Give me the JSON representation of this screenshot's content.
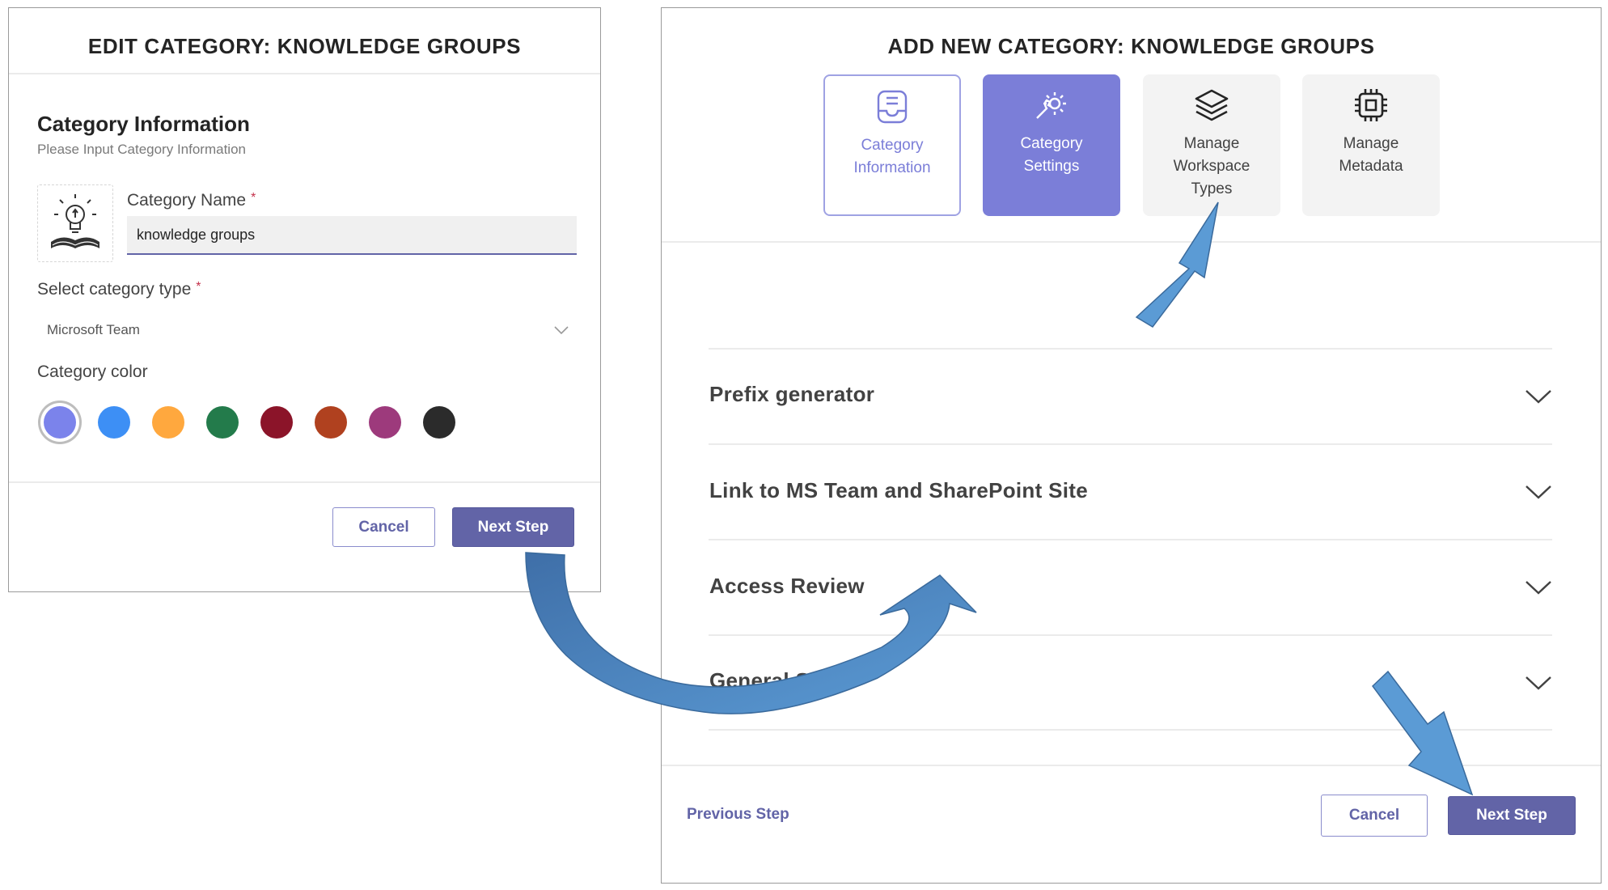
{
  "edit_panel": {
    "title": "EDIT CATEGORY: KNOWLEDGE GROUPS",
    "section_title": "Category Information",
    "section_subtitle": "Please Input Category Information",
    "name_label": "Category Name",
    "required_mark": "*",
    "name_value": "knowledge groups",
    "type_label": "Select category type",
    "type_value": "Microsoft Team",
    "color_label": "Category color",
    "colors": [
      "#7b83eb",
      "#3d8ff5",
      "#ffa83e",
      "#237b4b",
      "#8b1429",
      "#b0411f",
      "#9d3a7c",
      "#2b2b2b"
    ],
    "selected_color": "#7b83eb",
    "cancel_label": "Cancel",
    "next_label": "Next Step",
    "icon": "book-lightbulb-icon"
  },
  "add_panel": {
    "title": "ADD NEW CATEGORY: KNOWLEDGE GROUPS",
    "steps": [
      {
        "line1": "Category",
        "line2": "Information",
        "line3": "",
        "state": "done",
        "icon": "inbox-icon"
      },
      {
        "line1": "Category",
        "line2": "Settings",
        "line3": "",
        "state": "active",
        "icon": "wrench-gear-icon"
      },
      {
        "line1": "Manage",
        "line2": "Workspace",
        "line3": "Types",
        "state": "pending",
        "icon": "layers-icon"
      },
      {
        "line1": "Manage",
        "line2": "Metadata",
        "line3": "",
        "state": "pending",
        "icon": "chip-icon"
      }
    ],
    "sections": [
      "Prefix generator",
      "Link to MS Team and SharePoint Site",
      "Access Review",
      "General Setti"
    ],
    "previous_label": "Previous Step",
    "cancel_label": "Cancel",
    "next_label": "Next Step"
  },
  "colors": {
    "brand": "#6264a7",
    "active_step": "#7b7ed8",
    "arrow": "#5b9bd5"
  }
}
